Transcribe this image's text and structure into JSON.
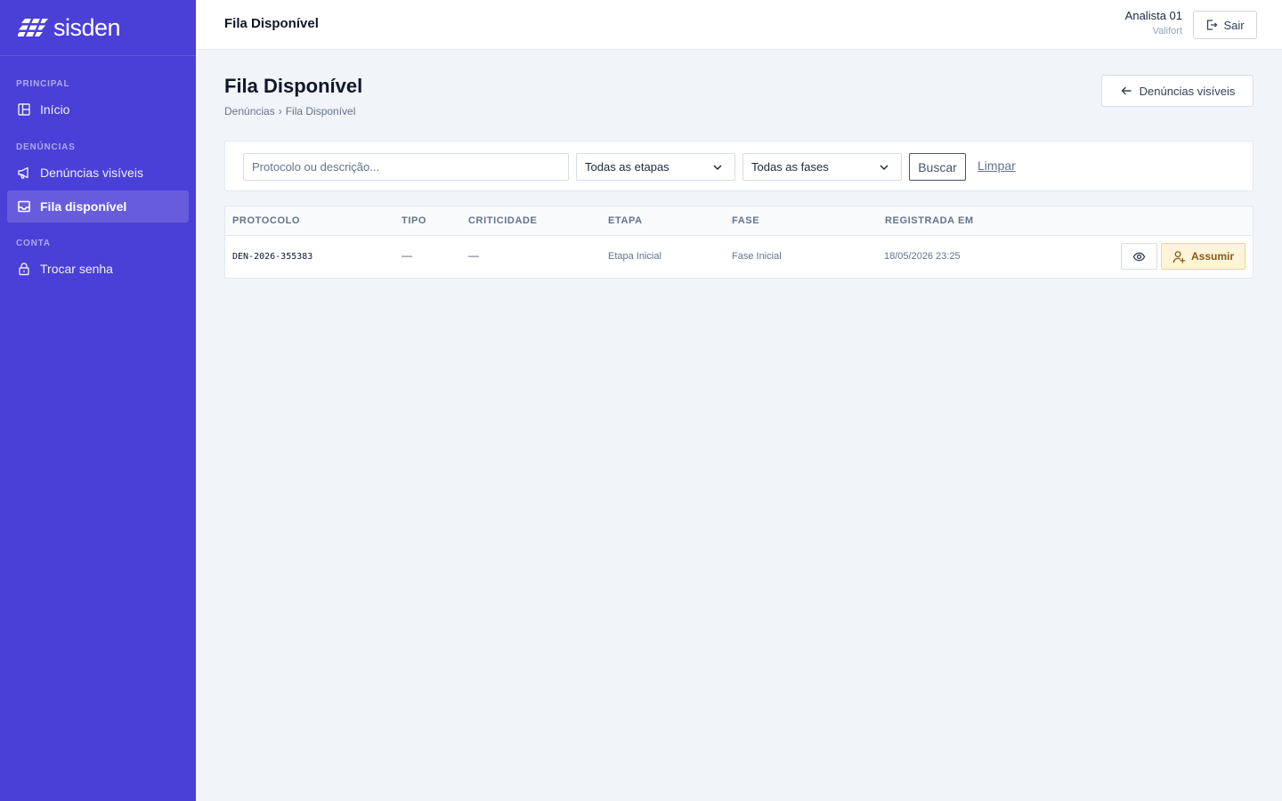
{
  "brand": {
    "name": "sisden"
  },
  "sidebar": {
    "sections": [
      {
        "label": "PRINCIPAL"
      },
      {
        "label": "DENÚNCIAS"
      },
      {
        "label": "CONTA"
      }
    ],
    "items": [
      {
        "label": "Início",
        "icon": "layout-icon",
        "active": false
      },
      {
        "label": "Denúncias visíveis",
        "icon": "megaphone-icon",
        "active": false
      },
      {
        "label": "Fila disponível",
        "icon": "inbox-icon",
        "active": true
      },
      {
        "label": "Trocar senha",
        "icon": "lock-icon",
        "active": false
      }
    ]
  },
  "topbar": {
    "title": "Fila Disponível",
    "user_name": "Analista 01",
    "user_org": "Valifort",
    "logout_label": "Sair"
  },
  "page": {
    "title": "Fila Disponível",
    "breadcrumb": [
      "Denúncias",
      "›",
      "Fila Disponível"
    ],
    "back_button": "Denúncias visíveis"
  },
  "filters": {
    "search_placeholder": "Protocolo ou descrição...",
    "stage_select": "Todas as etapas",
    "phase_select": "Todas as fases",
    "search_button": "Buscar",
    "clear_link": "Limpar"
  },
  "table": {
    "columns": [
      "PROTOCOLO",
      "TIPO",
      "CRITICIDADE",
      "ETAPA",
      "FASE",
      "REGISTRADA EM"
    ],
    "rows": [
      {
        "protocol": "DEN-2026-355383",
        "type": "—",
        "criticality": "—",
        "stage": "Etapa Inicial",
        "phase": "Fase Inicial",
        "registered_at": "18/05/2026 23:25",
        "assume_label": "Assumir"
      }
    ]
  },
  "colors": {
    "sidebar_bg": "#4a3fd6",
    "page_bg": "#f1f5f9",
    "assume_bg": "#fdf4d9",
    "assume_text": "#8a5a13"
  }
}
